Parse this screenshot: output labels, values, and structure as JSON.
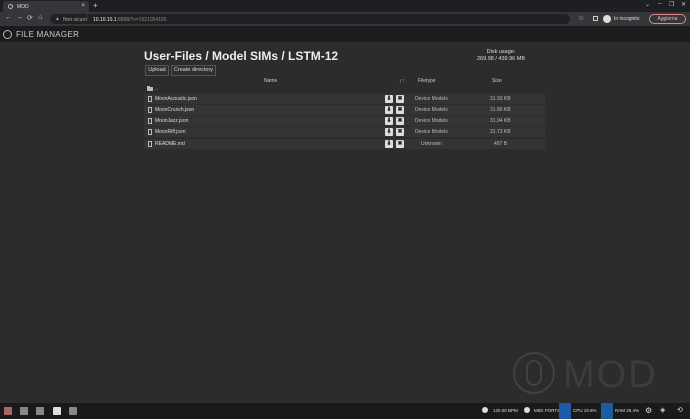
{
  "browser": {
    "tab_title": "MOD",
    "tab_close": "×",
    "new_tab": "+",
    "back": "←",
    "forward": "→",
    "reload": "⟳",
    "home": "⌂",
    "security_icon": "▲",
    "security_label": "Non sicuro",
    "url_host": "10.10.10.1",
    "url_rest": ":8888/?v=1521054165",
    "bookmark_star": "☆",
    "incognito_label": "In incognito",
    "update_button": "Aggiorna",
    "win_menu": "⌄",
    "win_min": "–",
    "win_max": "❐",
    "win_close": "✕"
  },
  "app": {
    "title": "FILE MANAGER"
  },
  "file_manager": {
    "breadcrumb": "User-Files / Model SIMs / LSTM-12",
    "disk_usage_label": "Disk usage:",
    "disk_usage_value": "269.98 / 439.96 MB",
    "upload_button": "Upload",
    "create_directory_button": "Create directory",
    "columns": {
      "name": "Name",
      "sort_icon": "↓↑",
      "filetype": "Filetype",
      "size": "Size"
    },
    "parent_dir": "..",
    "download_glyph": "⬇",
    "delete_glyph": "✖",
    "files": [
      {
        "name": "MoonAcoustic.json",
        "type": "Device Models",
        "size": "31.93 KB"
      },
      {
        "name": "MoonCrunch.json",
        "type": "Device Models",
        "size": "31.80 KB"
      },
      {
        "name": "MoonJazz.json",
        "type": "Device Models",
        "size": "31.94 KB"
      },
      {
        "name": "MoonRiff.json",
        "type": "Device Models",
        "size": "31.73 KB"
      },
      {
        "name": "README.md",
        "type": "Unknown",
        "size": "497 B"
      }
    ]
  },
  "watermark": {
    "text": "MOD"
  },
  "status_bar": {
    "bpm": "120.00 BPM",
    "midi": "MIDI PORTS",
    "cpu": "CPU 19.8%",
    "ram": "RAM 25.4%",
    "settings_glyph": "⚙"
  },
  "colors": {
    "background": "#2c2c2c",
    "header": "#1c1c1c",
    "row": "#343434",
    "status_accent": "#1e5aa8"
  }
}
